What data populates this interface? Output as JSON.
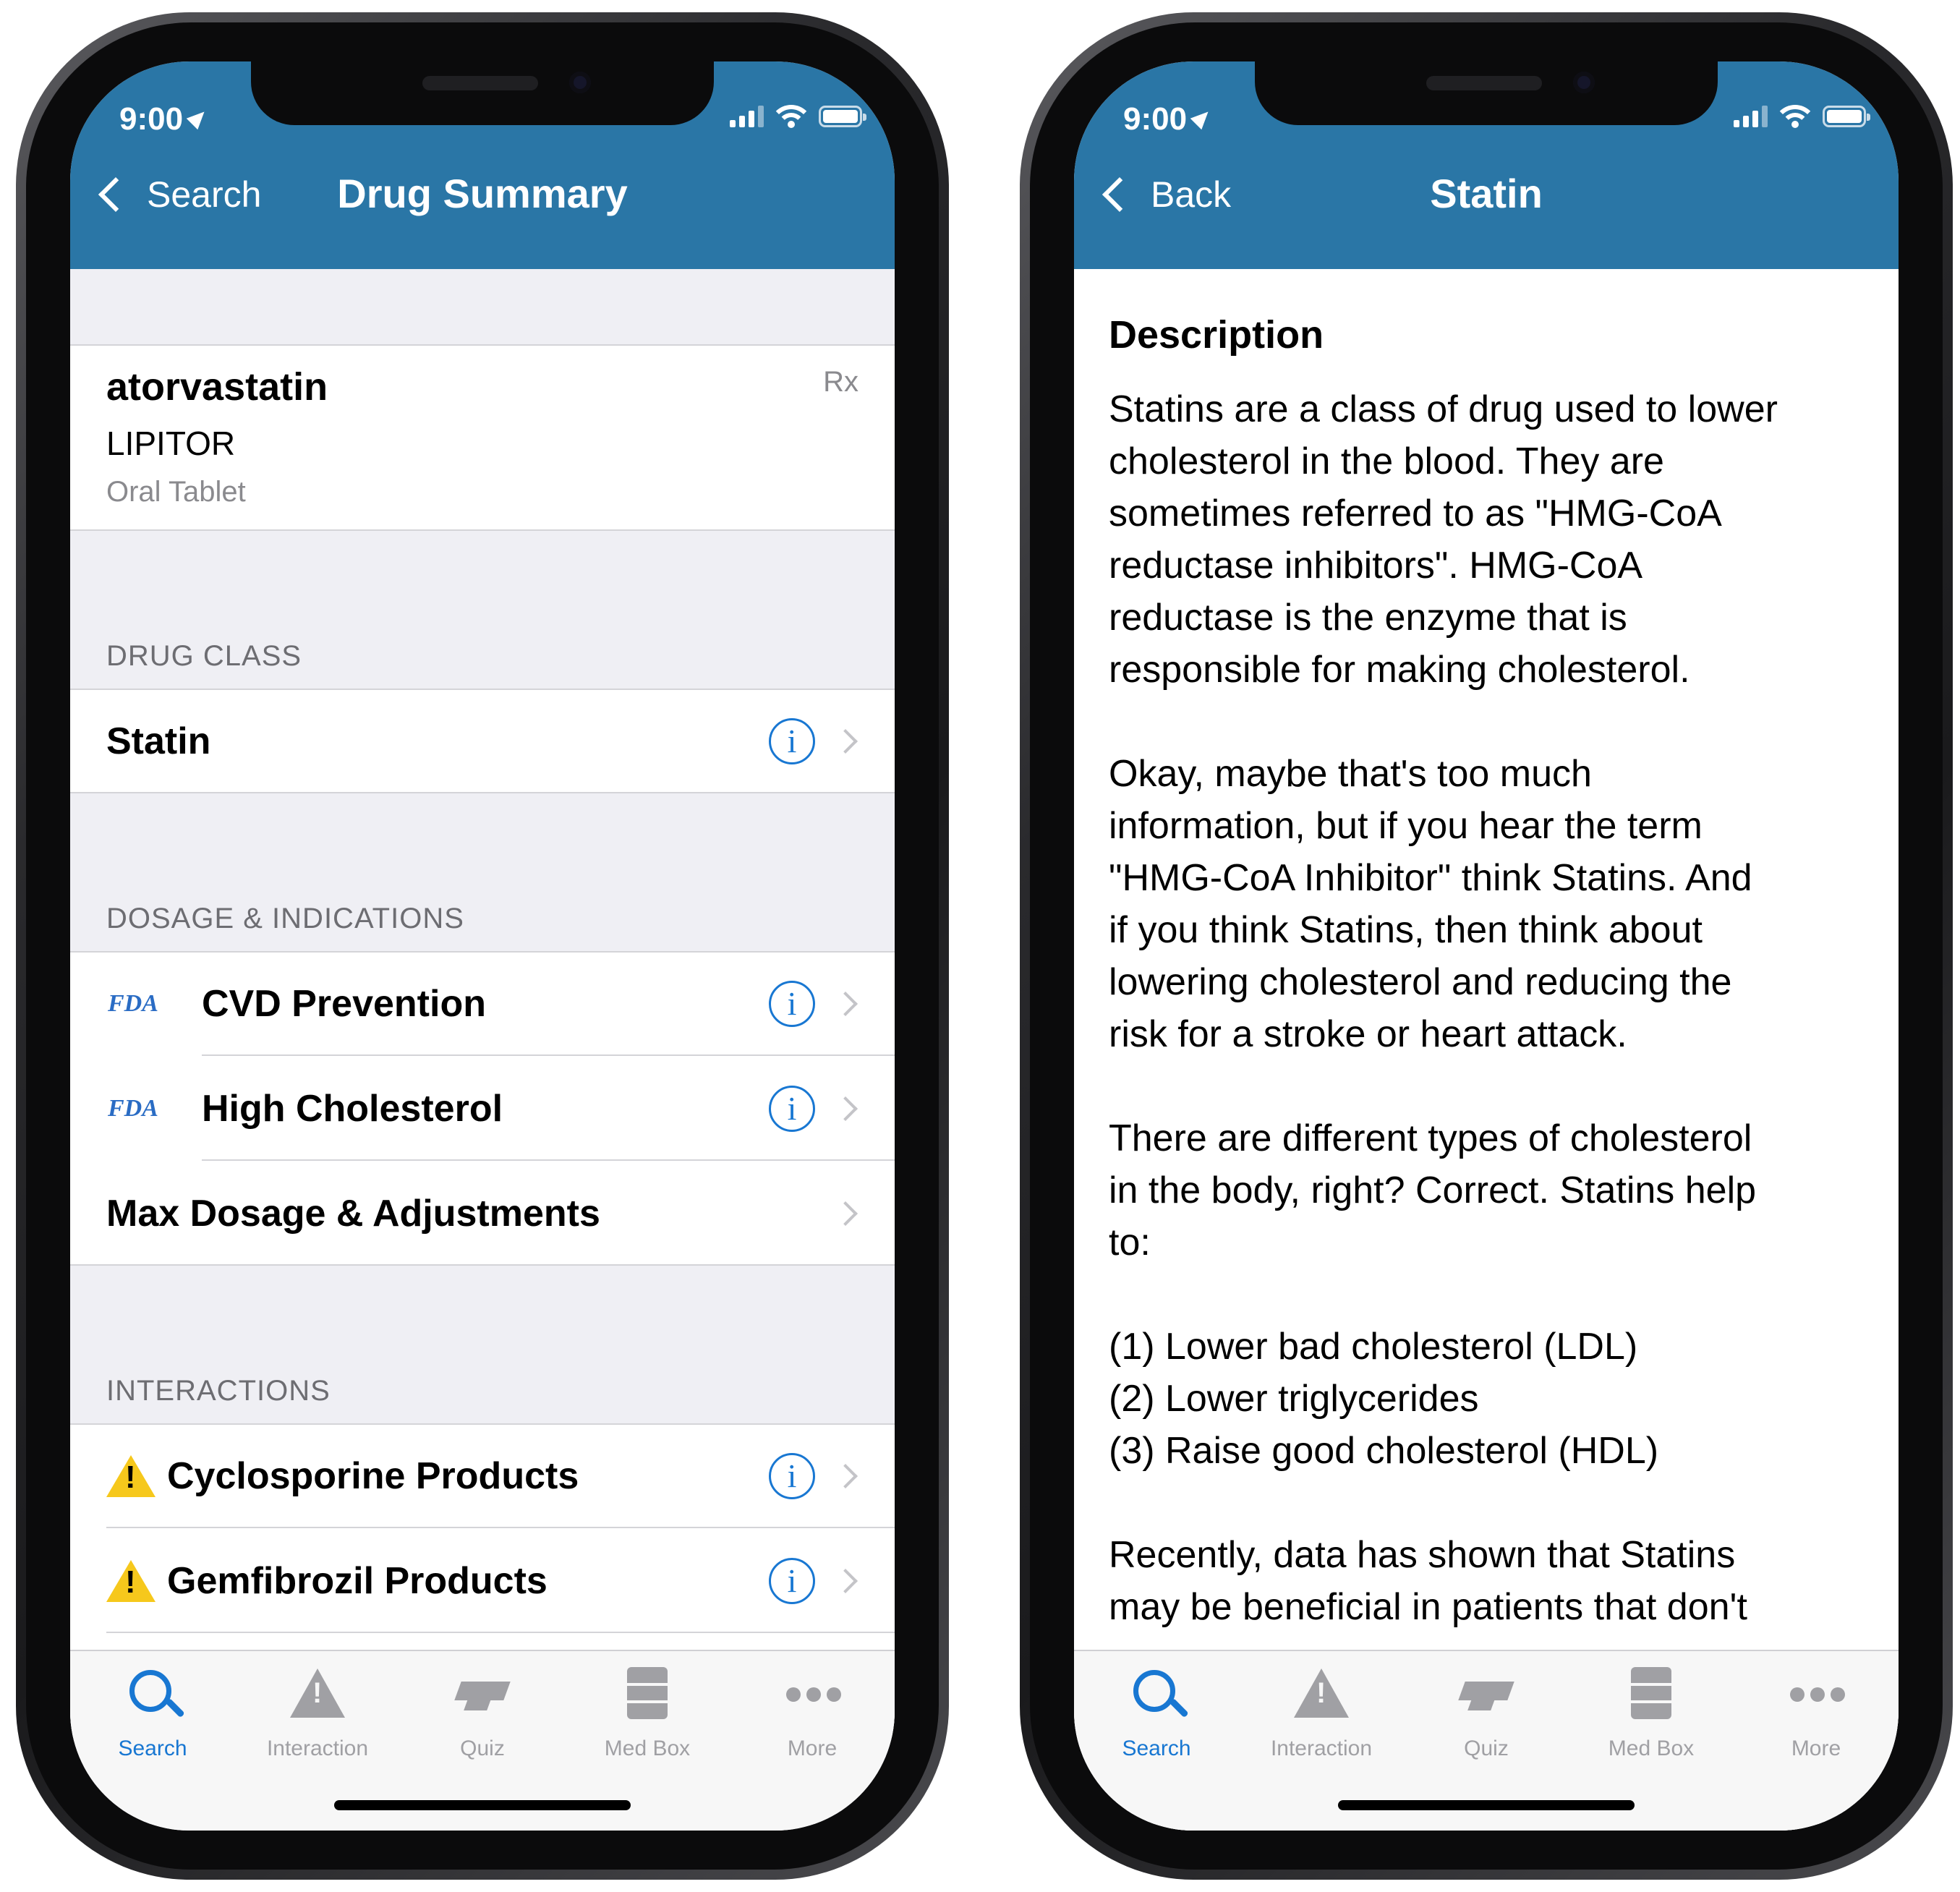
{
  "status": {
    "time": "9:00"
  },
  "left": {
    "nav": {
      "back_label": "Search",
      "title": "Drug Summary"
    },
    "drug": {
      "name": "atorvastatin",
      "brand": "LIPITOR",
      "form": "Oral Tablet",
      "rx": "Rx"
    },
    "sections": {
      "drug_class": {
        "header": "DRUG CLASS",
        "item": "Statin"
      },
      "dosage": {
        "header": "DOSAGE & INDICATIONS",
        "items": [
          {
            "badge": "FDA",
            "label": "CVD Prevention"
          },
          {
            "badge": "FDA",
            "label": "High Cholesterol"
          },
          {
            "label": "Max Dosage & Adjustments"
          }
        ]
      },
      "interactions": {
        "header": "INTERACTIONS",
        "items": [
          {
            "label": "Cyclosporine Products"
          },
          {
            "label": "Gemfibrozil Products"
          }
        ]
      }
    }
  },
  "right": {
    "nav": {
      "back_label": "Back",
      "title": "Statin"
    },
    "heading": "Description",
    "paragraphs": [
      "Statins are a class of drug used to lower\ncholesterol in the blood. They are\nsometimes referred to as \"HMG-CoA\nreductase inhibitors\". HMG-CoA\nreductase is the enzyme that is\nresponsible for making cholesterol.",
      "Okay, maybe that's too much\ninformation, but if you hear the term\n\"HMG-CoA Inhibitor\" think Statins. And\nif you think Statins, then think about\nlowering cholesterol and reducing the\nrisk for a stroke or heart attack.",
      "There are different types of cholesterol\nin the body, right? Correct. Statins help\nto:",
      "(1) Lower bad cholesterol (LDL)\n(2) Lower triglycerides\n(3) Raise good cholesterol (HDL)",
      "Recently, data has shown that Statins\nmay be beneficial in patients that don't"
    ]
  },
  "tabs": [
    {
      "label": "Search",
      "icon": "search-icon",
      "active": true
    },
    {
      "label": "Interaction",
      "icon": "warning-icon"
    },
    {
      "label": "Quiz",
      "icon": "graduation-cap-icon"
    },
    {
      "label": "Med Box",
      "icon": "cabinet-icon"
    },
    {
      "label": "More",
      "icon": "more-dots-icon"
    }
  ],
  "colors": {
    "nav_bg": "#2a76a6",
    "accent": "#1877d2",
    "warning": "#f6c81c",
    "grouped_bg": "#efeff4"
  }
}
